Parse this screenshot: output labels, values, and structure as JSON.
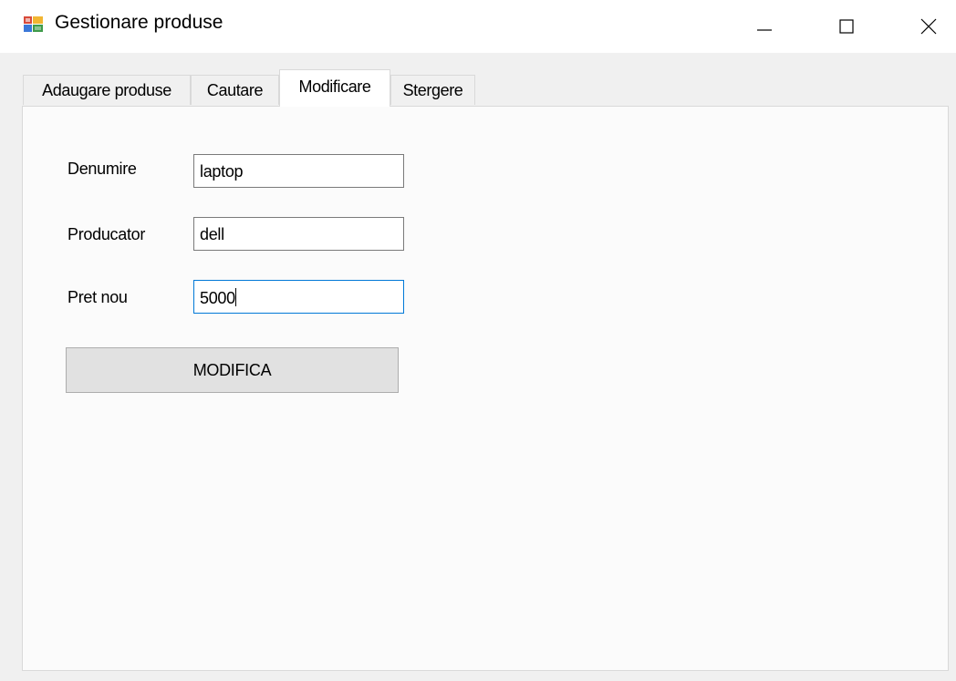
{
  "window": {
    "title": "Gestionare produse",
    "app_icon": "windows-forms-app-icon",
    "controls": {
      "minimize_icon": "minimize-icon",
      "maximize_icon": "maximize-icon",
      "close_icon": "close-icon"
    }
  },
  "tabs": [
    {
      "label": "Adaugare produse",
      "active": false
    },
    {
      "label": "Cautare",
      "active": false
    },
    {
      "label": "Modificare",
      "active": true
    },
    {
      "label": "Stergere",
      "active": false
    }
  ],
  "form": {
    "denumire": {
      "label": "Denumire",
      "value": "laptop"
    },
    "producator": {
      "label": "Producator",
      "value": "dell"
    },
    "pret_nou": {
      "label": "Pret nou",
      "value": "5000"
    },
    "submit_label": "MODIFICA"
  },
  "colors": {
    "focus_border": "#0078d7",
    "button_face": "#e1e1e1",
    "window_bg": "#f0f0f0"
  }
}
